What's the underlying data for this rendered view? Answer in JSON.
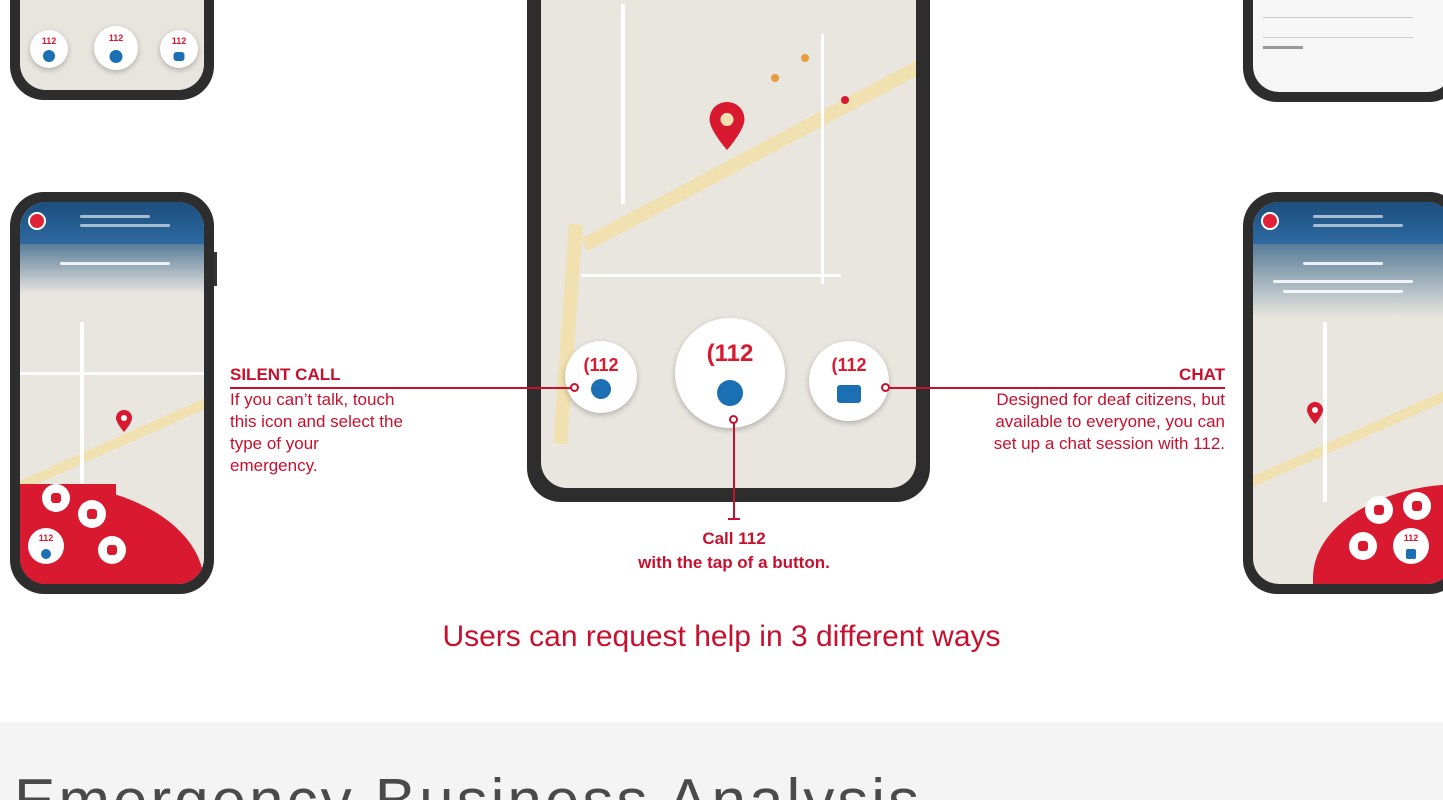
{
  "silent_call": {
    "title": "SILENT CALL",
    "description": "If you can’t talk, touch this icon and select the type of your emergency."
  },
  "chat": {
    "title": "CHAT",
    "description": "Designed for deaf citizens, but available to everyone, you can set up a chat session with 112."
  },
  "call": {
    "title": "Call 112",
    "description": "with the tap of a button."
  },
  "emergency_number": "112",
  "caption": "Users can request help in 3 different ways",
  "section_title": "Emergency Business Analysis",
  "colors": {
    "accent": "#c8102e",
    "button_red": "#d8192f",
    "icon_blue": "#1b6fb3",
    "phone_frame": "#2d2d2d"
  },
  "icons": [
    "phone-icon",
    "silent-call-icon",
    "voice-call-icon",
    "chat-bubble-icon",
    "map-pin-icon"
  ]
}
